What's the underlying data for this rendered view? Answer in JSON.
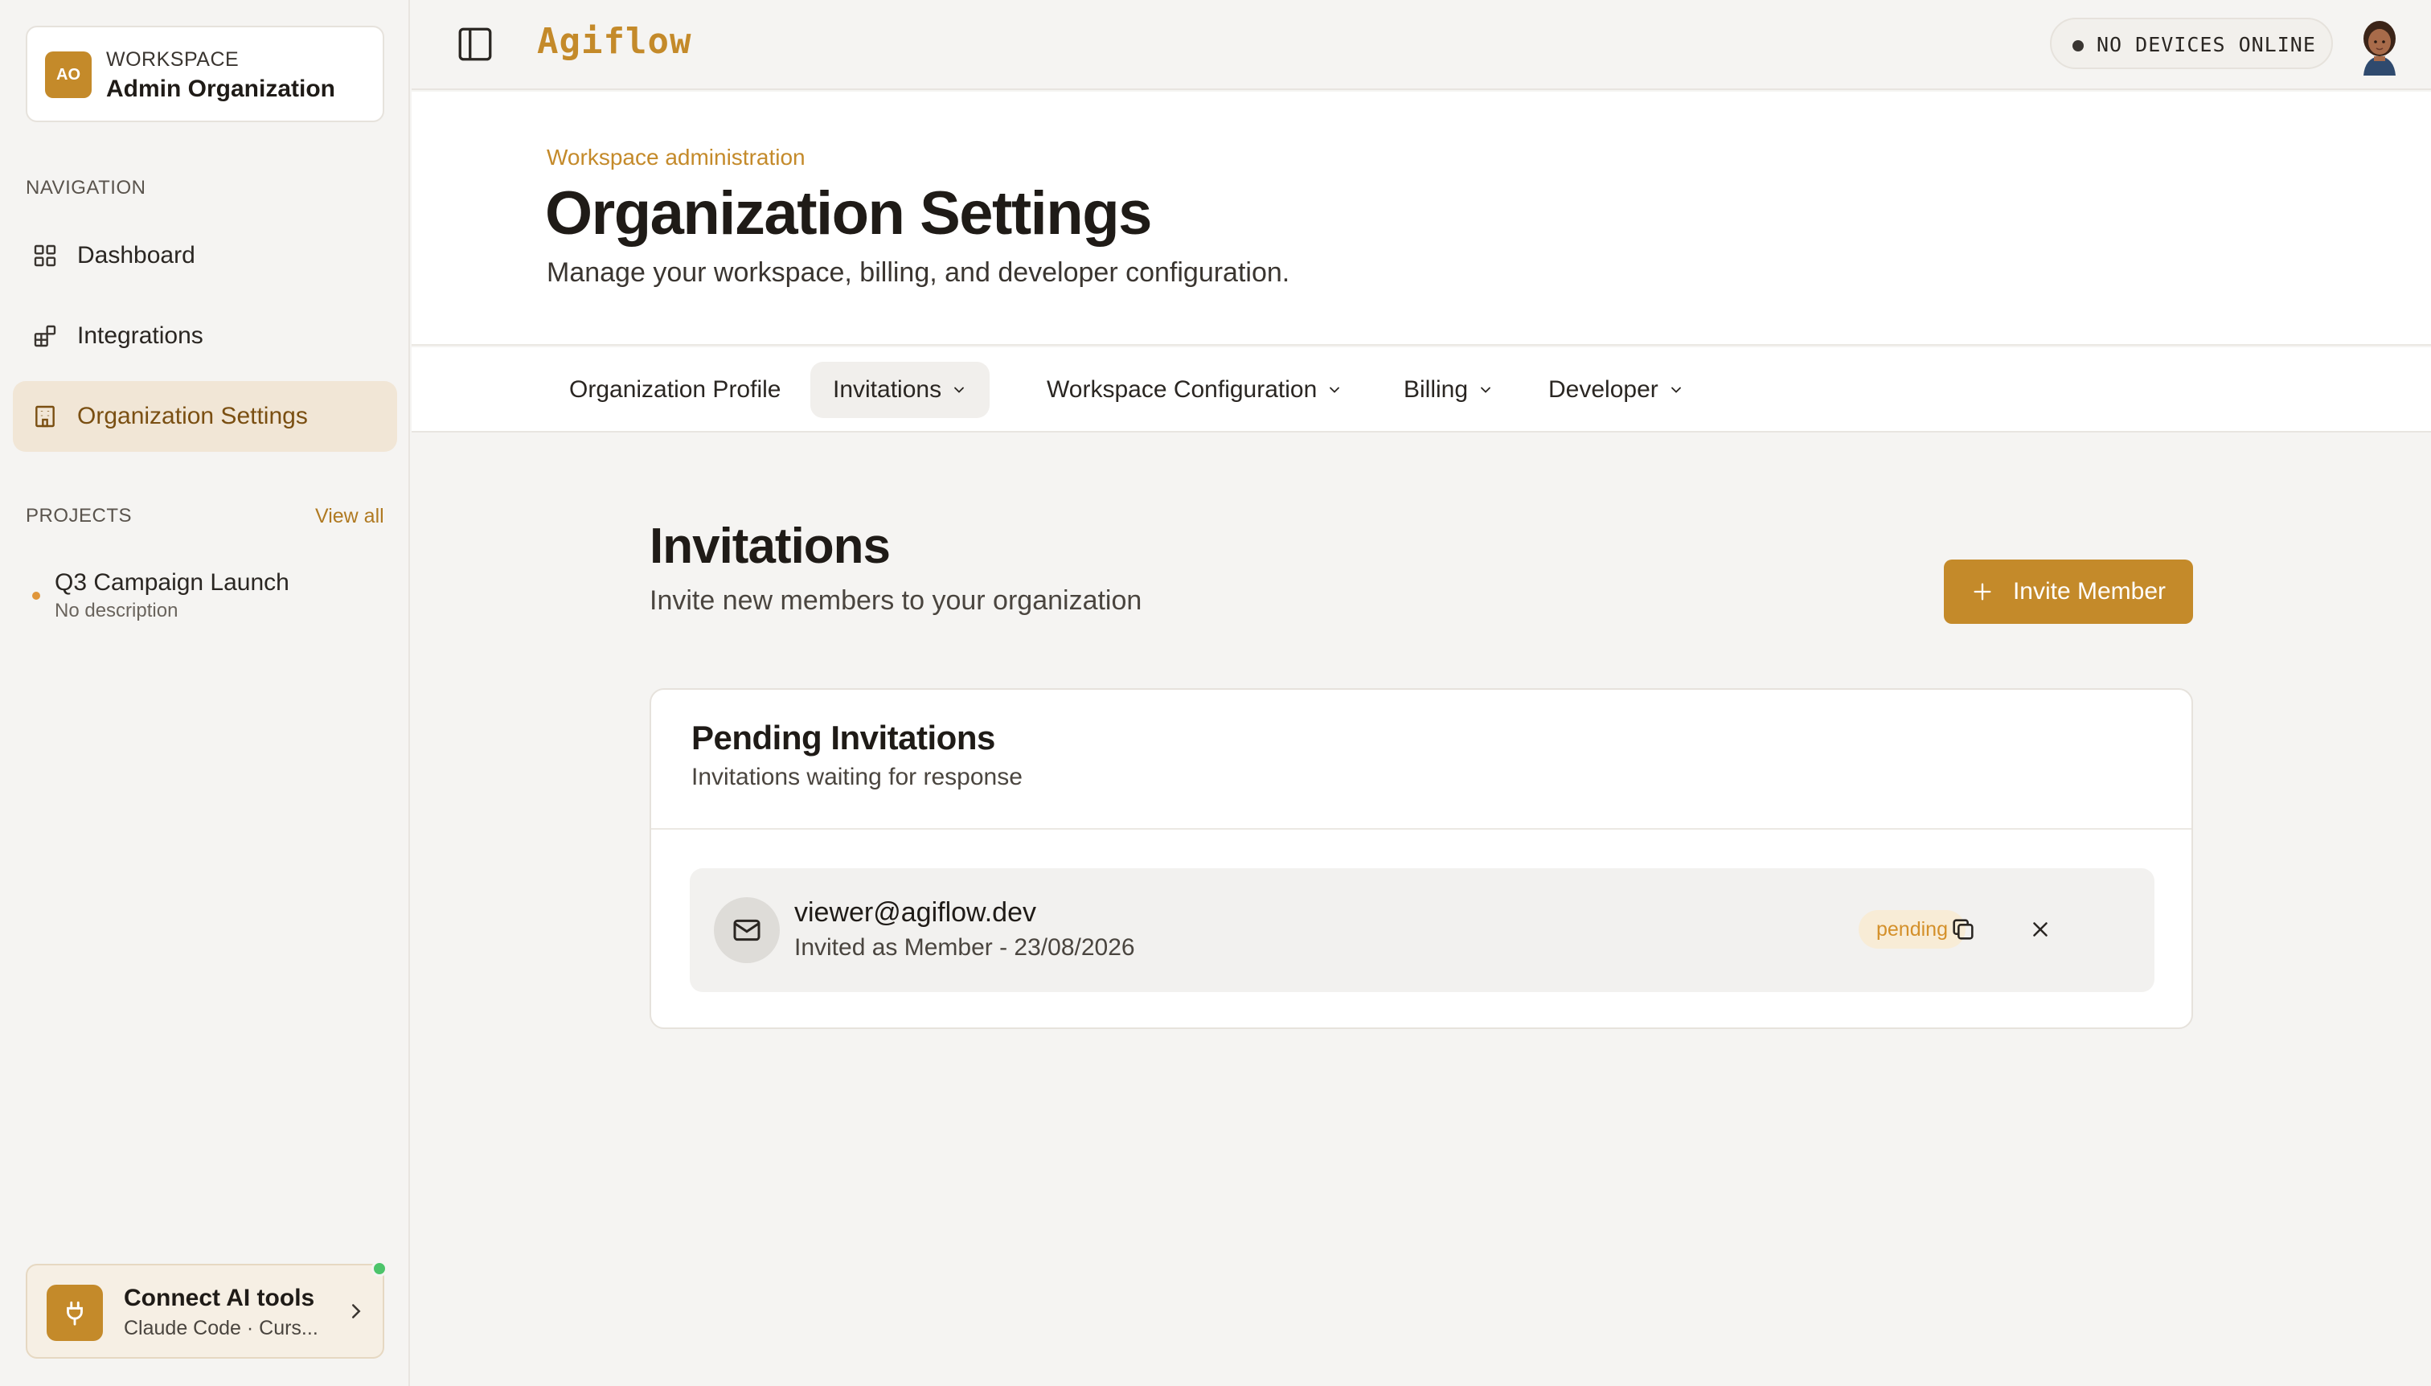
{
  "workspace": {
    "initials": "AO",
    "label": "WORKSPACE",
    "name": "Admin Organization"
  },
  "sidebar": {
    "nav_label": "NAVIGATION",
    "items": [
      {
        "label": "Dashboard",
        "icon": "grid-icon"
      },
      {
        "label": "Integrations",
        "icon": "blocks-icon"
      },
      {
        "label": "Organization Settings",
        "icon": "building-icon",
        "active": true
      }
    ],
    "projects_label": "PROJECTS",
    "view_all": "View all",
    "projects": [
      {
        "name": "Q3 Campaign Launch",
        "description": "No description"
      }
    ],
    "connect": {
      "title": "Connect AI tools",
      "subtitle": "Claude Code · Curs...",
      "icon": "plug-icon"
    }
  },
  "topbar": {
    "brand": "Agiflow",
    "devices_status": "NO DEVICES ONLINE"
  },
  "header": {
    "eyebrow": "Workspace administration",
    "title": "Organization Settings",
    "subtitle": "Manage your workspace, billing, and developer configuration."
  },
  "tabs": [
    {
      "label": "Organization Profile",
      "has_dropdown": false
    },
    {
      "label": "Invitations",
      "has_dropdown": true,
      "active": true
    },
    {
      "label": "Workspace Configuration",
      "has_dropdown": true
    },
    {
      "label": "Billing",
      "has_dropdown": true
    },
    {
      "label": "Developer",
      "has_dropdown": true
    }
  ],
  "content": {
    "title": "Invitations",
    "subtitle": "Invite new members to your organization",
    "invite_button": "Invite Member"
  },
  "pending_card": {
    "title": "Pending Invitations",
    "subtitle": "Invitations waiting for response",
    "invitations": [
      {
        "email": "viewer@agiflow.dev",
        "meta": "Invited as Member - 23/08/2026",
        "status": "pending"
      }
    ]
  },
  "colors": {
    "accent": "#c48a2a",
    "active_nav_bg": "#f1e6d6",
    "badge_bg": "#f8ecd6",
    "badge_text": "#d4902a",
    "online": "#4cc46a"
  }
}
